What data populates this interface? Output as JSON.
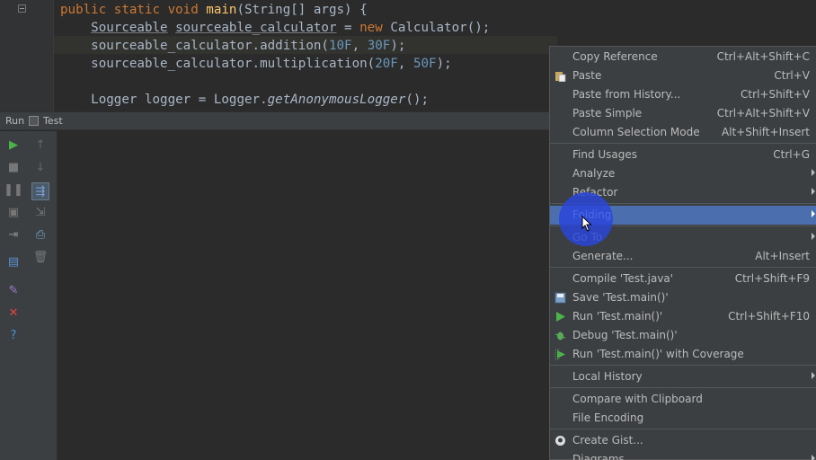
{
  "editor": {
    "lines": [
      [
        {
          "t": "public static void ",
          "c": "kw"
        },
        {
          "t": "main",
          "c": "fn"
        },
        {
          "t": "(String[] args) {"
        }
      ],
      [
        {
          "t": "    "
        },
        {
          "t": "Sourceable",
          "c": "ul"
        },
        {
          "t": " "
        },
        {
          "t": "sourceable_calculator",
          "c": "ul"
        },
        {
          "t": " = "
        },
        {
          "t": "new ",
          "c": "kw"
        },
        {
          "t": "Calculator();"
        }
      ],
      [
        {
          "t": "    sourceable_calculator.addition("
        },
        {
          "t": "10F",
          "c": "num"
        },
        {
          "t": ", "
        },
        {
          "t": "30F",
          "c": "num"
        },
        {
          "t": ");"
        }
      ],
      [
        {
          "t": "    sourceable_calculator.multiplication("
        },
        {
          "t": "20F",
          "c": "num"
        },
        {
          "t": ", "
        },
        {
          "t": "50F",
          "c": "num"
        },
        {
          "t": ");"
        }
      ],
      [
        {
          "t": ""
        }
      ],
      [
        {
          "t": "    Logger logger = Logger."
        },
        {
          "t": "getAnonymousLogger",
          "c": "ital"
        },
        {
          "t": "();"
        }
      ]
    ]
  },
  "run_panel": {
    "title": "Run",
    "tab_label": "Test"
  },
  "toolbar_icons": [
    {
      "name": "rerun-icon",
      "glyph": "▶",
      "color": "#4ab34a"
    },
    {
      "name": "stop-icon",
      "glyph": "■",
      "color": "#777777"
    },
    {
      "name": "pause-icon",
      "glyph": "❚❚",
      "color": "#777777"
    },
    {
      "name": "dump-threads-icon",
      "glyph": "▣",
      "color": "#777777"
    },
    {
      "name": "exit-icon",
      "glyph": "⇥",
      "color": "#8a8a8a"
    },
    {
      "name": "layout-icon",
      "glyph": "▤",
      "color": "#5a8fd0"
    },
    {
      "name": "pin-icon",
      "glyph": "✎",
      "color": "#9a7fd0"
    },
    {
      "name": "close-icon",
      "glyph": "✕",
      "color": "#e04545"
    },
    {
      "name": "help-icon",
      "glyph": "?",
      "color": "#4a90d9"
    },
    {
      "name": "up-arrow-icon",
      "glyph": "↑",
      "color": "#666666"
    },
    {
      "name": "down-arrow-icon",
      "glyph": "↓",
      "color": "#666666"
    },
    {
      "name": "soft-wrap-icon",
      "glyph": "⇶",
      "color": "#7a9fd0"
    },
    {
      "name": "scroll-to-end-icon",
      "glyph": "⇲",
      "color": "#777777"
    },
    {
      "name": "print-icon",
      "glyph": "⎙",
      "color": "#7aa7c7"
    },
    {
      "name": "trash-icon",
      "glyph": "🗑",
      "color": "#777777"
    }
  ],
  "context_menu": {
    "items": [
      {
        "label": "Copy Reference",
        "shortcut": "Ctrl+Alt+Shift+C"
      },
      {
        "label": "Paste",
        "shortcut": "Ctrl+V",
        "icon": "paste-icon"
      },
      {
        "label": "Paste from History...",
        "shortcut": "Ctrl+Shift+V"
      },
      {
        "label": "Paste Simple",
        "shortcut": "Ctrl+Alt+Shift+V"
      },
      {
        "label": "Column Selection Mode",
        "shortcut": "Alt+Shift+Insert"
      },
      {
        "label": "Find Usages",
        "shortcut": "Ctrl+G"
      },
      {
        "label": "Analyze",
        "submenu": true
      },
      {
        "label": "Refactor",
        "submenu": true
      },
      {
        "label": "Folding",
        "submenu": true,
        "selected": true
      },
      {
        "label": "Go To",
        "submenu": true
      },
      {
        "label": "Generate...",
        "shortcut": "Alt+Insert"
      },
      {
        "label": "Compile 'Test.java'",
        "shortcut": "Ctrl+Shift+F9"
      },
      {
        "label": "Save 'Test.main()'",
        "icon": "save-config-icon"
      },
      {
        "label": "Run 'Test.main()'",
        "shortcut": "Ctrl+Shift+F10",
        "icon": "run-icon"
      },
      {
        "label": "Debug 'Test.main()'",
        "icon": "debug-icon"
      },
      {
        "label": "Run 'Test.main()' with Coverage",
        "icon": "coverage-icon"
      },
      {
        "label": "Local History",
        "submenu": true
      },
      {
        "label": "Compare with Clipboard"
      },
      {
        "label": "File Encoding"
      },
      {
        "label": "Create Gist...",
        "icon": "github-icon"
      },
      {
        "label": "Diagrams",
        "submenu": true
      }
    ]
  },
  "colors": {
    "editor_bg": "#2b2b2b",
    "menu_bg": "#3c3f41",
    "menu_selected": "#4b6eaf",
    "click_indicator": "#2846dc"
  }
}
